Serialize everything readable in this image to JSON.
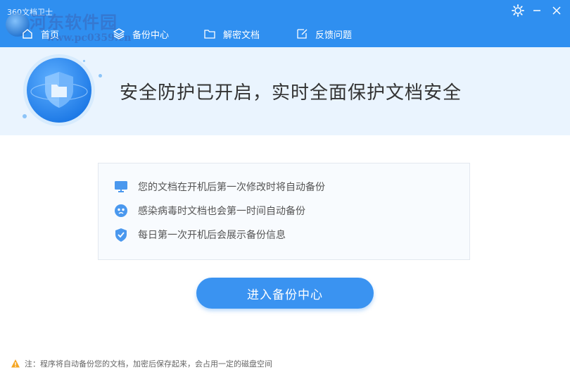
{
  "app": {
    "title": "360文档卫士"
  },
  "watermark": {
    "text": "河东软件园",
    "url": "www.pc0359.cn"
  },
  "nav": {
    "items": [
      {
        "label": "首页",
        "icon": "home-icon"
      },
      {
        "label": "备份中心",
        "icon": "layers-icon"
      },
      {
        "label": "解密文档",
        "icon": "folder-icon"
      },
      {
        "label": "反馈问题",
        "icon": "edit-icon"
      }
    ]
  },
  "window_controls": {
    "settings_icon": "gear-icon",
    "minimize_icon": "minimize-icon",
    "close_icon": "close-icon"
  },
  "hero": {
    "title": "安全防护已开启，实时全面保护文档安全",
    "badge_icon": "shield-folder-icon"
  },
  "features": [
    {
      "text": "您的文档在开机后第一次修改时将自动备份",
      "icon": "monitor-icon"
    },
    {
      "text": "感染病毒时文档也会第一时间自动备份",
      "icon": "virus-icon"
    },
    {
      "text": "每日第一次开机后会展示备份信息",
      "icon": "shield-check-icon"
    }
  ],
  "primary_button": {
    "label": "进入备份中心"
  },
  "footer_note": {
    "text": "注：程序将自动备份您的文档，加密后保存起来，会占用一定的磁盘空间",
    "icon": "warning-icon"
  },
  "colors": {
    "accent": "#2f8ff0",
    "hero_bg": "#eaf4fe",
    "button": "#3a93f1",
    "warning": "#f5a623"
  }
}
